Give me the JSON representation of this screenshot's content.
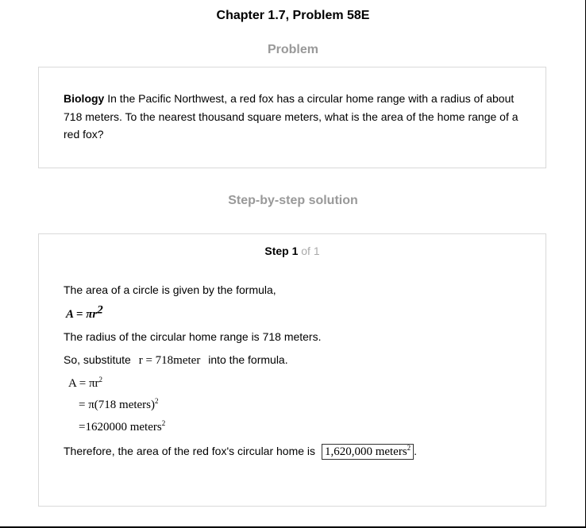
{
  "header": {
    "title": "Chapter 1.7, Problem 58E"
  },
  "problem": {
    "heading": "Problem",
    "term": "Biology",
    "text": "In the Pacific Northwest, a red fox has a circular home range with a radius of about 718 meters. To the nearest thousand square meters, what is the area of the home range of a red fox?"
  },
  "solution": {
    "heading": "Step-by-step solution",
    "step_label": "Step 1",
    "step_of": "of 1",
    "intro": "The area of a circle is given by the formula,",
    "formula_lhs": "A = πr",
    "formula_exp": "2",
    "radius_text": "The radius of the circular home range is 718 meters.",
    "sub_before": "So, substitute",
    "sub_math": "r = 718meter",
    "sub_after": "into the formula.",
    "work_line1": "A = πr",
    "work_line1_exp": "2",
    "work_line2": "= π(718 meters)",
    "work_line2_exp": "2",
    "work_line3": "=1620000 meters",
    "work_line3_exp": "2",
    "conclusion": "Therefore, the area of the red fox's circular home is",
    "answer": "1,620,000 meters",
    "answer_exp": "2",
    "period": "."
  }
}
